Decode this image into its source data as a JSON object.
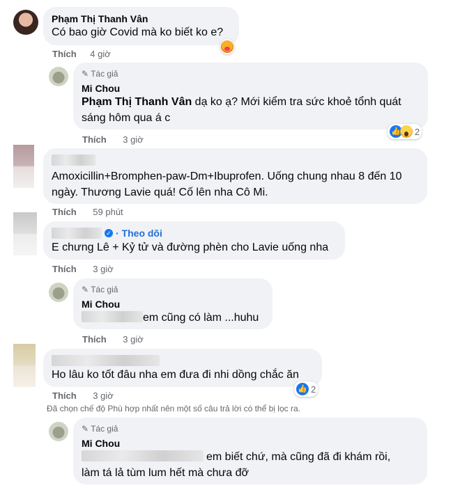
{
  "comments": [
    {
      "name": "Phạm Thị Thanh Vân",
      "text": "Có bao giờ Covid mà ko biết ko e?",
      "like_label": "Thích",
      "time": "4 giờ"
    },
    {
      "author_badge": "Tác giả",
      "name": "Mi Chou",
      "mention": "Phạm Thị Thanh Vân",
      "text": " dạ ko ạ? Mới kiểm tra sức khoẻ tổnh quát sáng hôm qua á c",
      "like_label": "Thích",
      "time": "3 giờ",
      "reaction_count": "2"
    },
    {
      "text": "Amoxicillin+Bromphen-paw-Dm+Ibuprofen. Uống chung nhau 8 đến 10 ngày. Thương Lavie quá! Cố lên nha Cô Mi.",
      "like_label": "Thích",
      "time": "59 phút"
    },
    {
      "follow_label": "· Theo dõi",
      "text": "E chưng Lê + Kỷ tử và đường phèn cho Lavie uống nha",
      "like_label": "Thích",
      "time": "3 giờ"
    },
    {
      "author_badge": "Tác giả",
      "name": "Mi Chou",
      "text": "em cũng có làm ...huhu",
      "like_label": "Thích",
      "time": "3 giờ"
    },
    {
      "text": "Ho lâu ko tốt đâu nha em đưa đi nhi dồng chắc ăn",
      "like_label": "Thích",
      "time": "3 giờ",
      "reaction_count": "2"
    },
    {
      "author_badge": "Tác giả",
      "name": "Mi Chou",
      "text_line1": "em biết chứ, mà cũng đã đi khám rồi,",
      "text_line2": "làm tá lả tùm lum hết mà chưa đỡ"
    }
  ],
  "filter_note": "Đã chọn chế độ Phù hợp nhất nên một số câu trả lời có thể bị lọc ra.",
  "icons": [
    "care-reaction",
    "like-reaction",
    "wow-reaction",
    "pencil-icon",
    "verified-icon"
  ],
  "colors": {
    "link": "#216fdb",
    "bubble": "#f0f2f5",
    "meta": "#65676b",
    "like_blue": "#1877f2"
  }
}
